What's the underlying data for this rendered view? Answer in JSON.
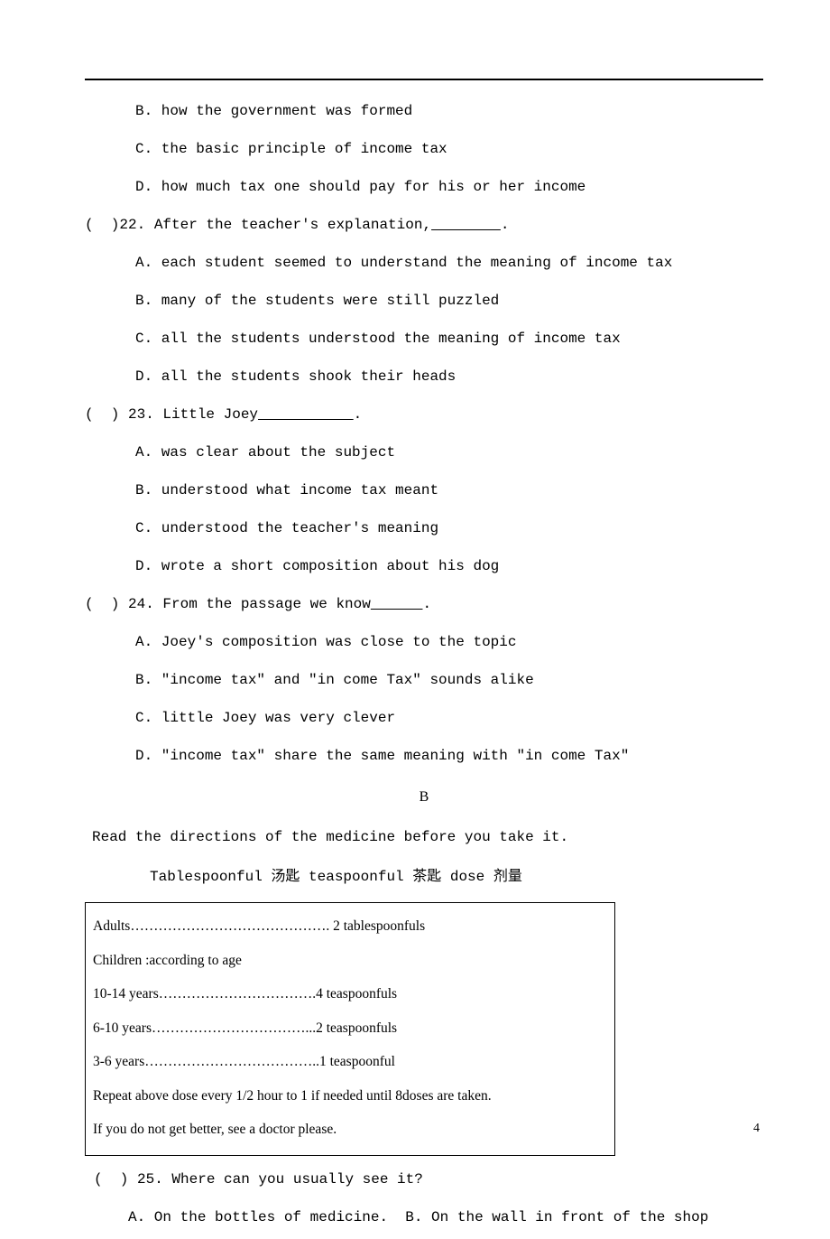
{
  "pageNumber": "4",
  "q21": {
    "B": "B. how the government was formed",
    "C": "C. the basic principle of income tax",
    "D": "D. how much tax one should pay for his or her income"
  },
  "q22": {
    "stem": "(  )22. After the teacher's explanation,",
    "blank": "        ",
    "tail": ".",
    "A": "A. each student seemed to understand the meaning of income tax",
    "B": "B. many of the students were still puzzled",
    "C": "C. all the students understood the meaning of income tax",
    "D": "D. all the students shook their heads"
  },
  "q23": {
    "stem": "(  ) 23. Little Joey",
    "blank": "           ",
    "tail": ".",
    "A": "A. was clear about the subject",
    "B": "B. understood what income tax meant",
    "C": "C. understood the teacher's meaning",
    "D": "D. wrote a short composition about his dog"
  },
  "q24": {
    "stem": "(  ) 24. From the passage we know",
    "blank": "      ",
    "tail": ".",
    "A": "A. Joey's composition was close to the topic",
    "B": "B. \"income tax\" and \"in come Tax\" sounds alike",
    "C": "C. little Joey was very clever",
    "D": "D. \"income tax\" share the same meaning with \"in come Tax\""
  },
  "sectionB": {
    "heading": "B",
    "intro": "Read the directions of the medicine before you take it.",
    "vocab": "Tablespoonful  汤匙   teaspoonful 茶匙    dose 剂量"
  },
  "dosage": {
    "adults": "Adults……………………………………. 2 tablespoonfuls",
    "childrenHeading": " Children :according to age",
    "r10_14": "10-14 years…………………………….4 teaspoonfuls",
    "r6_10": "6-10 years……………………………...2 teaspoonfuls",
    "r3_6": "3-6 years………………………………..1 teaspoonful",
    "repeat": "  Repeat above dose every 1/2 hour to 1 if needed until 8doses are taken.",
    "advice": "If you do not get better, see a doctor please."
  },
  "q25": {
    "stem": "(  ) 25. Where can you usually see it?",
    "AB": "A. On the bottles of medicine.  B. On the wall in front of the shop"
  }
}
